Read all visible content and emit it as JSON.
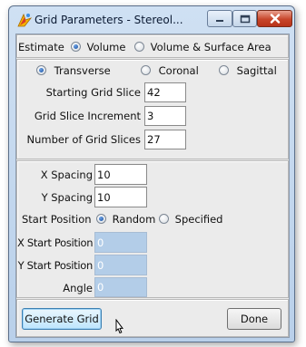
{
  "window": {
    "title": "Grid Parameters - Stereol...",
    "controls": {
      "minimize": "minimize",
      "maximize": "maximize",
      "close": "close"
    }
  },
  "estimate": {
    "label": "Estimate",
    "options": [
      {
        "label": "Volume",
        "selected": true
      },
      {
        "label": "Volume & Surface Area",
        "selected": false
      }
    ]
  },
  "orientation": {
    "options": [
      {
        "label": "Transverse",
        "selected": true
      },
      {
        "label": "Coronal",
        "selected": false
      },
      {
        "label": "Sagittal",
        "selected": false
      }
    ]
  },
  "slices": {
    "starting_label": "Starting Grid Slice",
    "starting_value": "42",
    "increment_label": "Grid Slice Increment",
    "increment_value": "3",
    "count_label": "Number of Grid Slices",
    "count_value": "27"
  },
  "spacing": {
    "x_label": "X Spacing",
    "x_value": "10",
    "y_label": "Y Spacing",
    "y_value": "10"
  },
  "start_position": {
    "label": "Start Position",
    "options": [
      {
        "label": "Random",
        "selected": true
      },
      {
        "label": "Specified",
        "selected": false
      }
    ],
    "x_label": "X Start Position",
    "x_value": "0",
    "y_label": "Y Start Position",
    "y_value": "0",
    "angle_label": "Angle",
    "angle_value": "0"
  },
  "actions": {
    "generate_label": "Generate Grid",
    "done_label": "Done"
  }
}
